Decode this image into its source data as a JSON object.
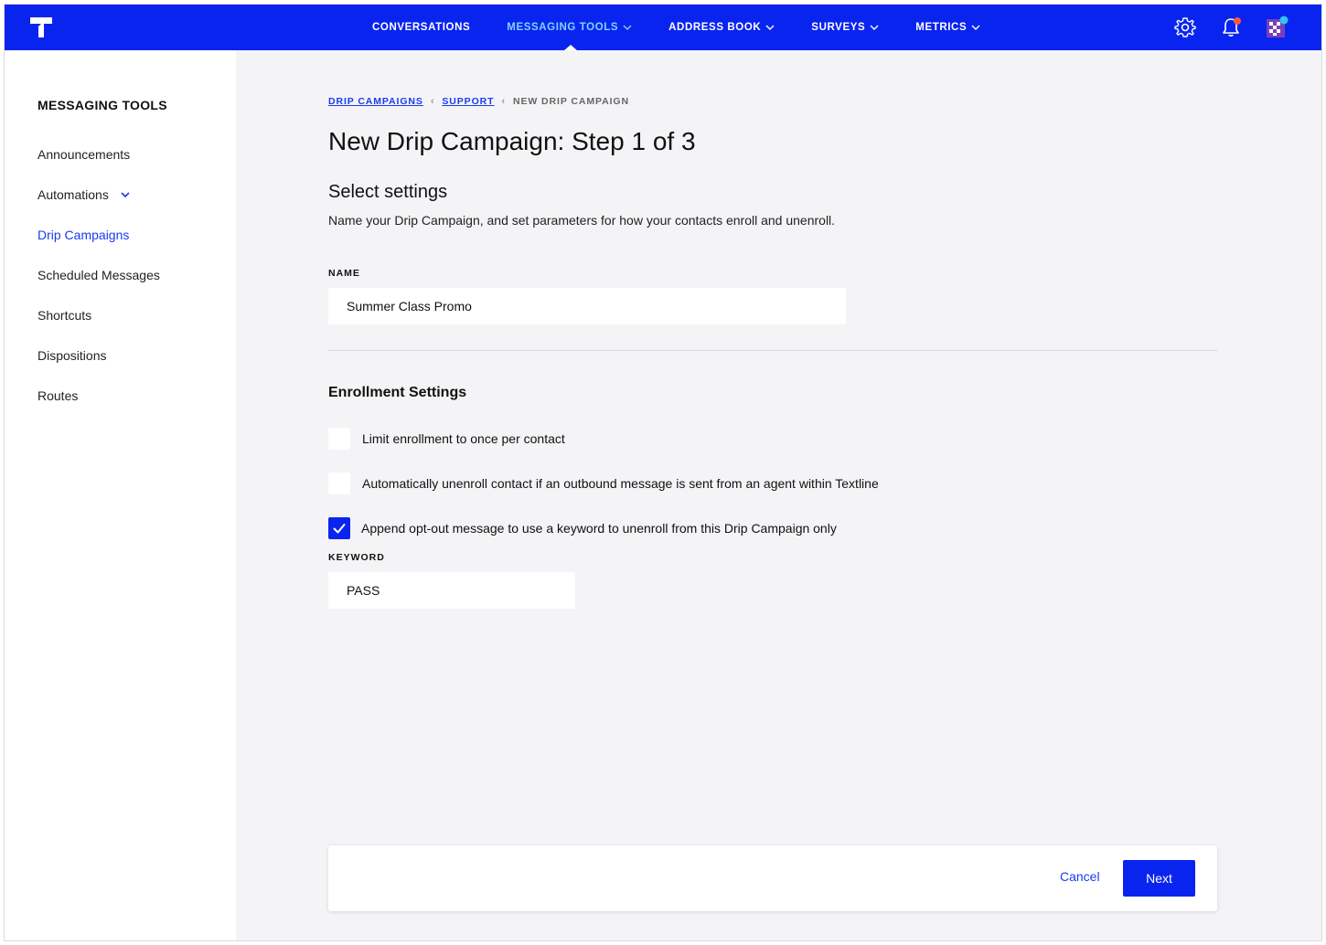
{
  "nav": {
    "items": [
      {
        "label": "CONVERSATIONS",
        "dropdown": false,
        "active": false
      },
      {
        "label": "MESSAGING TOOLS",
        "dropdown": true,
        "active": true
      },
      {
        "label": "ADDRESS BOOK",
        "dropdown": true,
        "active": false
      },
      {
        "label": "SURVEYS",
        "dropdown": true,
        "active": false
      },
      {
        "label": "METRICS",
        "dropdown": true,
        "active": false
      }
    ],
    "icons": [
      "gear-icon",
      "bell-icon",
      "avatar"
    ],
    "colors": {
      "bar": "#0a24f0",
      "active_text": "#7fd4ff",
      "notification_dot": "#ff5a3c",
      "avatar_dot": "#2ec5f0"
    }
  },
  "sidebar": {
    "title": "MESSAGING TOOLS",
    "items": [
      {
        "label": "Announcements",
        "active": false
      },
      {
        "label": "Automations",
        "active": false,
        "expandable": true
      },
      {
        "label": "Drip Campaigns",
        "active": true
      },
      {
        "label": "Scheduled Messages",
        "active": false
      },
      {
        "label": "Shortcuts",
        "active": false
      },
      {
        "label": "Dispositions",
        "active": false
      },
      {
        "label": "Routes",
        "active": false
      }
    ]
  },
  "breadcrumb": {
    "items": [
      "DRIP CAMPAIGNS",
      "SUPPORT"
    ],
    "current": "NEW DRIP CAMPAIGN"
  },
  "page": {
    "title": "New Drip Campaign: Step 1 of 3",
    "section_title": "Select settings",
    "section_desc": "Name your Drip Campaign, and set parameters for how your contacts enroll and unenroll."
  },
  "form": {
    "name_label": "NAME",
    "name_value": "Summer Class Promo",
    "enrollment_title": "Enrollment Settings",
    "options": [
      {
        "label": "Limit enrollment to once per contact",
        "checked": false
      },
      {
        "label": "Automatically unenroll contact if an outbound message is sent from an agent within Textline",
        "checked": false
      },
      {
        "label": "Append opt-out message to use a keyword to unenroll from this Drip Campaign only",
        "checked": true
      }
    ],
    "keyword_label": "KEYWORD",
    "keyword_value": "PASS"
  },
  "footer": {
    "cancel_label": "Cancel",
    "next_label": "Next"
  }
}
